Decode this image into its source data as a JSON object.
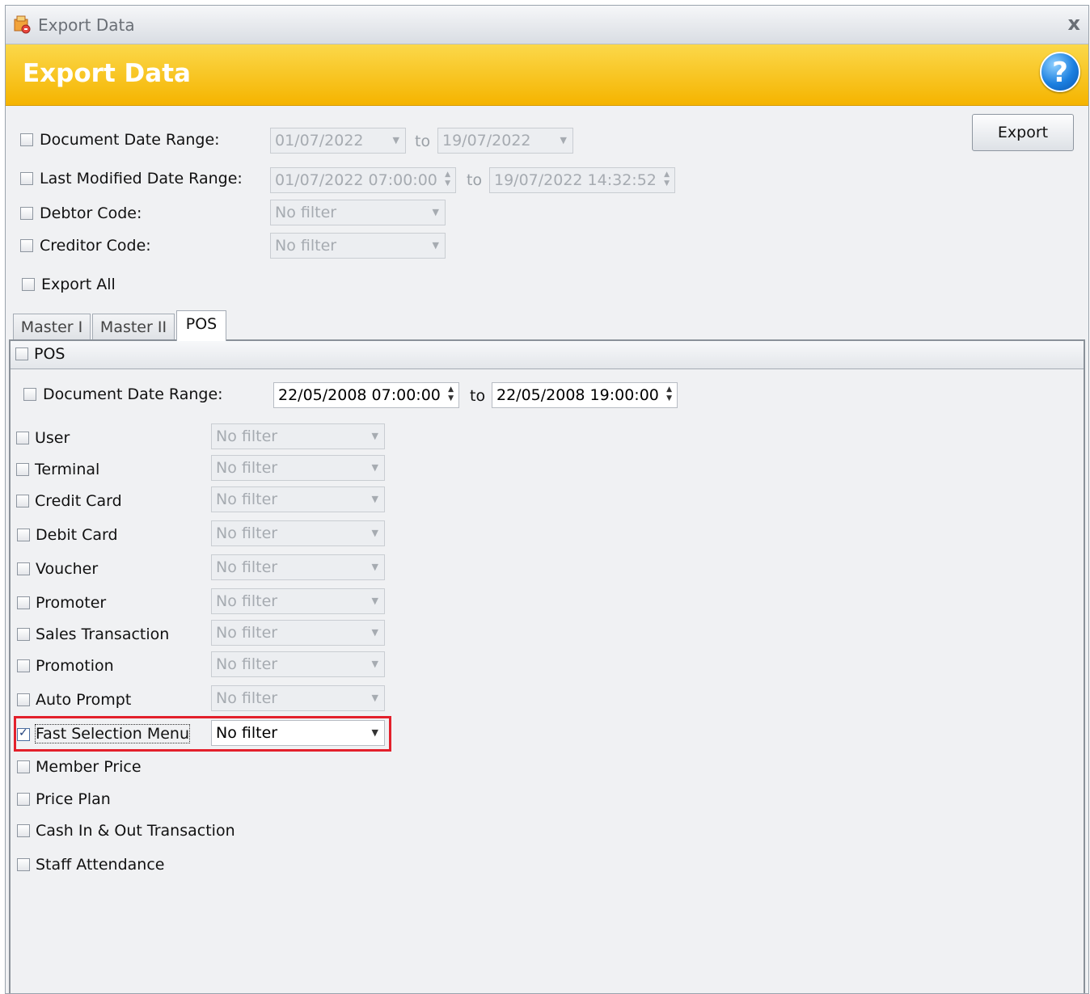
{
  "window": {
    "title": "Export Data",
    "close_glyph": "x"
  },
  "banner": {
    "title": "Export Data",
    "help_glyph": "?"
  },
  "top_filters": {
    "document_date": {
      "label": "Document Date Range:",
      "from": "01/07/2022",
      "to_label": "to",
      "to": "19/07/2022",
      "checked": false
    },
    "last_modified": {
      "label": "Last Modified Date Range:",
      "from": "01/07/2022 07:00:00",
      "to_label": "to",
      "to": "19/07/2022 14:32:52",
      "checked": false
    },
    "debtor": {
      "label": "Debtor Code:",
      "value": "No filter",
      "checked": false
    },
    "creditor": {
      "label": "Creditor Code:",
      "value": "No filter",
      "checked": false
    },
    "export_all": {
      "label": "Export All",
      "checked": false
    }
  },
  "export_button": {
    "label": "Export"
  },
  "tabs": [
    {
      "label": "Master I",
      "active": false
    },
    {
      "label": "Master II",
      "active": false
    },
    {
      "label": "POS",
      "active": true
    }
  ],
  "pos": {
    "group_label": "POS",
    "document_date": {
      "label": "Document Date Range:",
      "from": "22/05/2008 07:00:00",
      "to_label": "to",
      "to": "22/05/2008 19:00:00"
    },
    "items": [
      {
        "label": "User",
        "value": "No filter",
        "checked": false
      },
      {
        "label": "Terminal",
        "value": "No filter",
        "checked": false
      },
      {
        "label": "Credit Card",
        "value": "No filter",
        "checked": false
      },
      {
        "label": "Debit Card",
        "value": "No filter",
        "checked": false
      },
      {
        "label": "Voucher",
        "value": "No filter",
        "checked": false
      },
      {
        "label": "Promoter",
        "value": "No filter",
        "checked": false
      },
      {
        "label": "Sales Transaction",
        "value": "No filter",
        "checked": false
      },
      {
        "label": "Promotion",
        "value": "No filter",
        "checked": false
      },
      {
        "label": "Auto Prompt",
        "value": "No filter",
        "checked": false
      },
      {
        "label": "Fast Selection Menu",
        "value": "No filter",
        "checked": true
      },
      {
        "label": "Member Price",
        "checked": false
      },
      {
        "label": "Price Plan",
        "checked": false
      },
      {
        "label": "Cash In & Out Transaction",
        "checked": false
      },
      {
        "label": "Staff Attendance",
        "checked": false
      }
    ]
  },
  "colors": {
    "banner": "#f5b400",
    "highlight": "#e3202b",
    "help": "#1b7fe0"
  }
}
